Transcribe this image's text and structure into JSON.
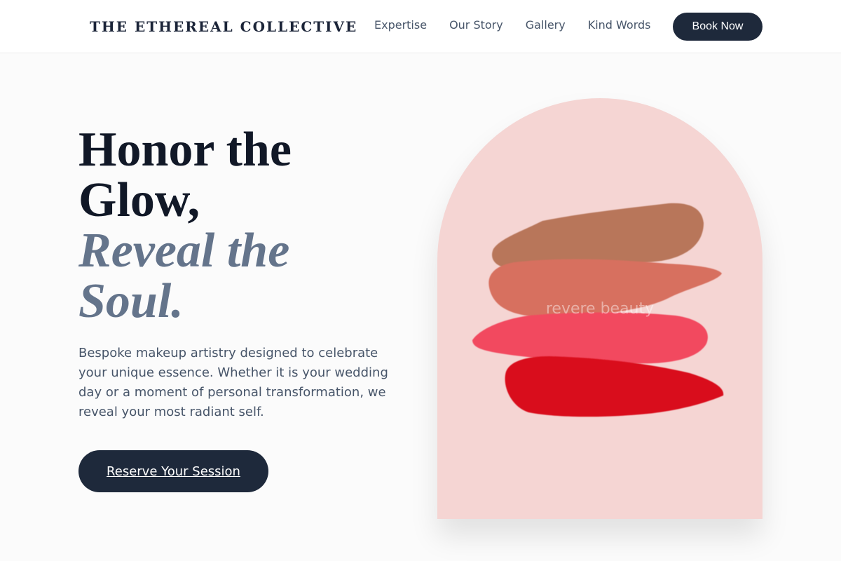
{
  "header": {
    "brand": "THE ETHEREAL COLLECTIVE",
    "nav": [
      "Expertise",
      "Our Story",
      "Gallery",
      "Kind Words"
    ],
    "cta_label": "Book Now"
  },
  "hero": {
    "title_line1": "Honor the",
    "title_line2": "Glow,",
    "title_line3": "Reveal the",
    "title_line4": "Soul.",
    "description": "Bespoke makeup artistry designed to celebrate your unique essence. Whether it is your wedding day or a moment of personal transformation, we reveal your most radiant self.",
    "cta_label": "Reserve Your Session"
  },
  "image": {
    "watermark": "revere beauty",
    "swatch_colors": [
      "#b8765a",
      "#d7705f",
      "#f2485f",
      "#d9101d"
    ]
  },
  "colors": {
    "primary": "#1e293b",
    "accent_text": "#64748b",
    "arch_bg": "#f5d5d3"
  }
}
